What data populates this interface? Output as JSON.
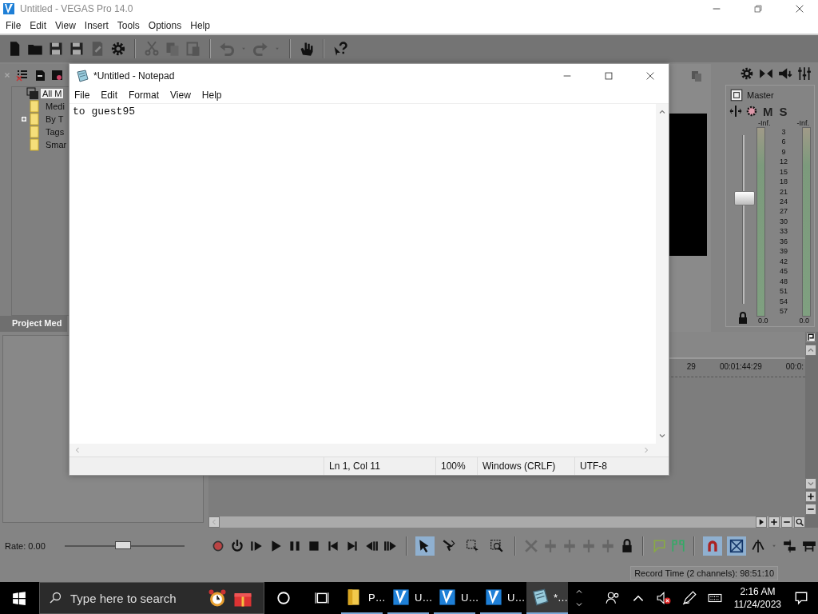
{
  "window": {
    "title": "Untitled - VEGAS Pro 14.0"
  },
  "menu": [
    "File",
    "Edit",
    "View",
    "Insert",
    "Tools",
    "Options",
    "Help"
  ],
  "project_media": {
    "tree": [
      {
        "label": "All M",
        "selected": true,
        "children": [
          {
            "label": "Medi",
            "selected": false
          },
          {
            "label": "By T",
            "selected": false,
            "expanded": false
          },
          {
            "label": "Tags",
            "selected": false
          },
          {
            "label": "Smar",
            "selected": false
          }
        ]
      }
    ],
    "tab": "Project Med"
  },
  "mixer": {
    "title": "Master",
    "mute": "M",
    "solo": "S",
    "fader": {
      "level": 0.62
    },
    "peaks": [
      "-Inf.",
      "-Inf."
    ],
    "scale": [
      "3",
      "6",
      "9",
      "12",
      "15",
      "18",
      "21",
      "24",
      "27",
      "30",
      "33",
      "36",
      "39",
      "42",
      "45",
      "48",
      "51",
      "54",
      "57"
    ],
    "readings": [
      "0.0",
      "0.0"
    ]
  },
  "timeline": {
    "ruler": [
      "29",
      "00:01:44:29",
      "00:0:"
    ]
  },
  "rate": {
    "label": "Rate: 0.00",
    "level": 0.49
  },
  "edit_tools": [
    {
      "selected": true
    },
    {
      "selected": false
    },
    {
      "selected": false
    },
    {
      "selected": false
    }
  ],
  "snap_tools": [
    {
      "selected": true
    },
    {
      "selected": true
    }
  ],
  "status": "Record Time (2 channels): 98:51:10",
  "notepad": {
    "title": "*Untitled - Notepad",
    "menu": [
      "File",
      "Edit",
      "Format",
      "View",
      "Help"
    ],
    "text": "to guest95",
    "status": [
      "Ln 1, Col 11",
      "100%",
      "Windows (CRLF)",
      "UTF-8"
    ]
  },
  "taskbar": {
    "search": {
      "placeholder": "Type here to search"
    },
    "tasks": [
      {
        "label": "P…",
        "kind": "folder",
        "selected": false
      },
      {
        "label": "U…",
        "kind": "vegas",
        "selected": false
      },
      {
        "label": "U…",
        "kind": "vegas",
        "selected": false
      },
      {
        "label": "U…",
        "kind": "vegas",
        "selected": false
      },
      {
        "label": "*…",
        "kind": "notepad",
        "selected": true
      }
    ],
    "time": "2:16 AM",
    "date": "11/24/2023"
  }
}
